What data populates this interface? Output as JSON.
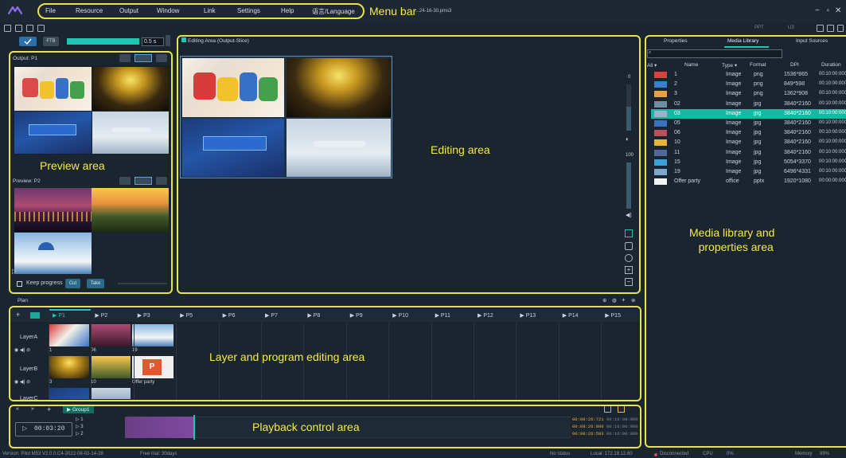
{
  "menu": [
    "File",
    "Resource",
    "Output",
    "Window",
    "Link",
    "Settings",
    "Help",
    "语言/Language"
  ],
  "title_file": "...24-16-30.pms3",
  "annotations": {
    "menu_bar": "Menu bar",
    "preview_area": "Preview area",
    "editing_area": "Editing area",
    "media_library": "Media library and properties area",
    "media_library_l1": "Media library and",
    "media_library_l2": "properties area",
    "layer_program": "Layer and program editing area",
    "playback": "Playback control area"
  },
  "top_right": {
    "ppt": "PPT",
    "u3": "U3"
  },
  "toolbar": {
    "ftb": "FTB",
    "duration": "0.5",
    "unit": "s"
  },
  "output_panel": {
    "title": "Output: P1"
  },
  "preview_panel": {
    "title": "Preview: P2"
  },
  "keep_progress": "Keep progress",
  "cut_label": "Cut",
  "take_label": "Take",
  "editing": {
    "title": "Editing Area (Output-Slice)",
    "slider_top": "0",
    "slider_mid": "100"
  },
  "tabs": [
    "Properties",
    "Media Library",
    "Input Sources"
  ],
  "media_columns": [
    "All",
    "Name",
    "Type",
    "Format",
    "DPI",
    "Duration"
  ],
  "media_rows": [
    {
      "name": "1",
      "type": "Image",
      "format": "png",
      "dpi": "1536*865",
      "duration": "00:10:00:000"
    },
    {
      "name": "2",
      "type": "Image",
      "format": "png",
      "dpi": "849*598",
      "duration": "00:10:00:000"
    },
    {
      "name": "3",
      "type": "Image",
      "format": "png",
      "dpi": "1362*908",
      "duration": "00:10:00:000"
    },
    {
      "name": "02",
      "type": "Image",
      "format": "jpg",
      "dpi": "3840*2160",
      "duration": "00:10:00:000"
    },
    {
      "name": "03",
      "type": "Image",
      "format": "jpg",
      "dpi": "3840*2160",
      "duration": "00:10:00:000"
    },
    {
      "name": "05",
      "type": "Image",
      "format": "jpg",
      "dpi": "3840*2160",
      "duration": "00:10:00:000"
    },
    {
      "name": "06",
      "type": "Image",
      "format": "jpg",
      "dpi": "3840*2160",
      "duration": "00:10:00:000"
    },
    {
      "name": "10",
      "type": "Image",
      "format": "jpg",
      "dpi": "3840*2160",
      "duration": "00:10:00:000"
    },
    {
      "name": "11",
      "type": "Image",
      "format": "jpg",
      "dpi": "3840*2160",
      "duration": "00:10:00:000"
    },
    {
      "name": "15",
      "type": "Image",
      "format": "jpg",
      "dpi": "5054*3370",
      "duration": "00:10:00:000"
    },
    {
      "name": "19",
      "type": "Image",
      "format": "jpg",
      "dpi": "6496*4331",
      "duration": "00:10:00:000"
    },
    {
      "name": "Offer party",
      "type": "office",
      "format": "pptx",
      "dpi": "1920*1080",
      "duration": "00:00:00:000"
    }
  ],
  "selected_row": 4,
  "plan": {
    "title": "Plan",
    "programs": [
      "P1",
      "P2",
      "P3",
      "P5",
      "P6",
      "P7",
      "P8",
      "P9",
      "P10",
      "P11",
      "P12",
      "P13",
      "P14",
      "P15"
    ],
    "layers": [
      {
        "name": "LayerA",
        "labels": [
          "1",
          "06",
          "19"
        ]
      },
      {
        "name": "LayerB",
        "labels": [
          "3",
          "10",
          "Offer party"
        ]
      },
      {
        "name": "LayerC",
        "labels": []
      }
    ]
  },
  "playback": {
    "group": "Group1",
    "timecode": "00:03:20",
    "tracks": [
      "1",
      "3",
      "2"
    ],
    "times": [
      {
        "a": "00:08:26:721",
        "b": "00:10:00:000"
      },
      {
        "a": "00:08:26:800",
        "b": "00:10:00:000"
      },
      {
        "a": "00:08:26:593",
        "b": "00:10:00:000"
      }
    ]
  },
  "status": {
    "version": "Version: Pilot M53 V2.0.0.C4-2022-08-02-14-28",
    "trial": "Free trial: 30days",
    "state": "No status",
    "local": "Local: 172.18.12.60",
    "connection": "Disconnected",
    "cpu_label": "CPU",
    "cpu_value": "0%",
    "memory_label": "Memory",
    "memory_value": "89%"
  },
  "colors": {
    "accent": "#1fc5b0",
    "annotation": "#e9e34a",
    "selected_row": "#17b7a1"
  }
}
